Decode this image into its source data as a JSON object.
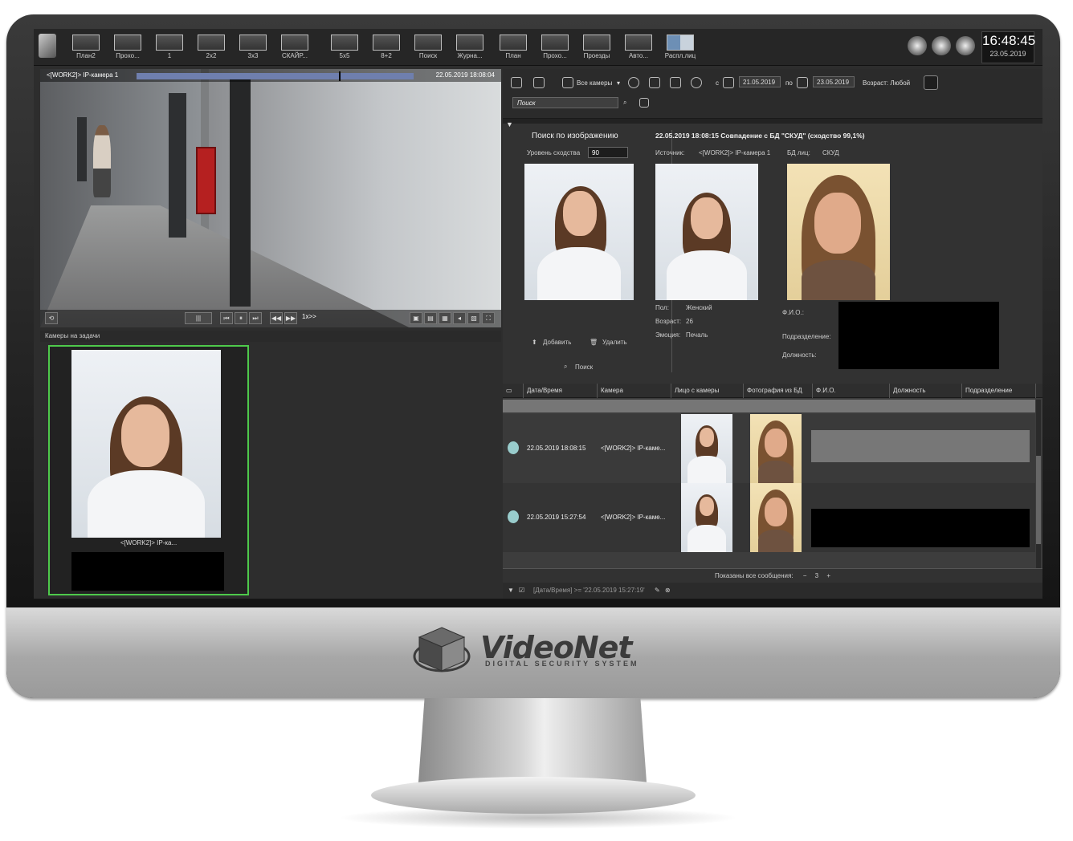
{
  "toolbar": {
    "buttons": [
      {
        "label": "План2"
      },
      {
        "label": "Прохо..."
      },
      {
        "label": "1"
      },
      {
        "label": "2x2"
      },
      {
        "label": "3x3"
      },
      {
        "label": "СКАЙР..."
      },
      {
        "label": "5x5"
      },
      {
        "label": "8+2"
      },
      {
        "label": "Поиск"
      },
      {
        "label": "Журна..."
      },
      {
        "label": "План"
      },
      {
        "label": "Прохо..."
      },
      {
        "label": "Проезды"
      },
      {
        "label": "Авто..."
      },
      {
        "label": "Распл.лиц"
      }
    ],
    "clock_time": "16:48:45",
    "clock_date": "23.05.2019"
  },
  "video": {
    "camera": "<[WORK2]> IP-камера 1",
    "timestamp": "22.05.2019 18:08:04",
    "speed": "1x>>"
  },
  "lower_left": {
    "header": "Камеры на задачи",
    "tile_label": "<[WORK2]> IP-ка..."
  },
  "right": {
    "all_cameras": "Все камеры",
    "from_label": "с",
    "date_from": "21.05.2019",
    "to_label": "по",
    "date_to": "23.05.2019",
    "age_label": "Возраст: Любой",
    "search_placeholder": "Поиск",
    "image_search_title": "Поиск по изображению",
    "similarity_label": "Уровень сходства",
    "similarity_value": "90",
    "add_label": "Добавить",
    "delete_label": "Удалить",
    "search_label": "Поиск",
    "match_title": "22.05.2019 18:08:15 Совпадение с БД \"СКУД\" (сходство 99,1%)",
    "source_label": "Источник:",
    "source_value": "<[WORK2]> IP-камера 1",
    "db_label": "БД лиц:",
    "db_value": "СКУД",
    "gender_label": "Пол:",
    "gender_value": "Женский",
    "age_label2": "Возраст:",
    "age_value": "26",
    "emotion_label": "Эмоция:",
    "emotion_value": "Печаль",
    "fio_label": "Ф.И.О.:",
    "dept_label": "Подразделение:",
    "position_label": "Должность:"
  },
  "table": {
    "headers": [
      "Дата/Время",
      "Камера",
      "Лицо с камеры",
      "Фотография из БД",
      "Ф.И.О.",
      "Должность",
      "Подразделение"
    ],
    "rows": [
      {
        "datetime": "22.05.2019 18:08:15",
        "camera": "<[WORK2]> IP-каме..."
      },
      {
        "datetime": "22.05.2019 15:27:54",
        "camera": "<[WORK2]> IP-каме..."
      }
    ],
    "footer": "Показаны все сообщения:",
    "count": "3",
    "filter": "[Дата/Время] >= '22.05.2019 15:27:19'"
  },
  "brand": {
    "name": "VideoNet",
    "subtitle": "DIGITAL SECURITY SYSTEM"
  },
  "colors": {
    "accent_green": "#4ec94b",
    "panel_bg": "#2d2d2d"
  }
}
